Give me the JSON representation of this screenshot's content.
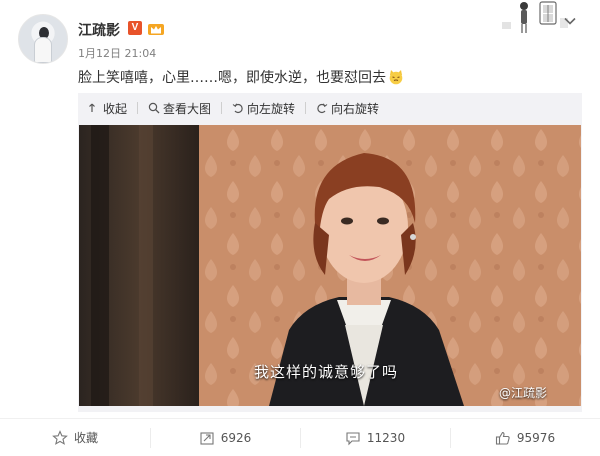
{
  "post": {
    "username": "江疏影",
    "verified_badge": "V",
    "timestamp": "1月12日 21:04",
    "text": "脸上笑嘻嘻，心里……嗯，即使水逆，也要怼回去",
    "emoji": "cat-emoji-icon"
  },
  "media_toolbar": {
    "collapse": "收起",
    "view_large": "查看大图",
    "rotate_left": "向左旋转",
    "rotate_right": "向右旋转"
  },
  "photo": {
    "caption": "我这样的诚意够了吗",
    "watermark": "@江疏影"
  },
  "footer": {
    "favorite": "收藏",
    "repost_count": "6926",
    "comment_count": "11230",
    "like_count": "95976"
  },
  "colors": {
    "badge_orange": "#e8532a",
    "crown_gold": "#f5a623",
    "photo_wall": "#c58a66"
  }
}
